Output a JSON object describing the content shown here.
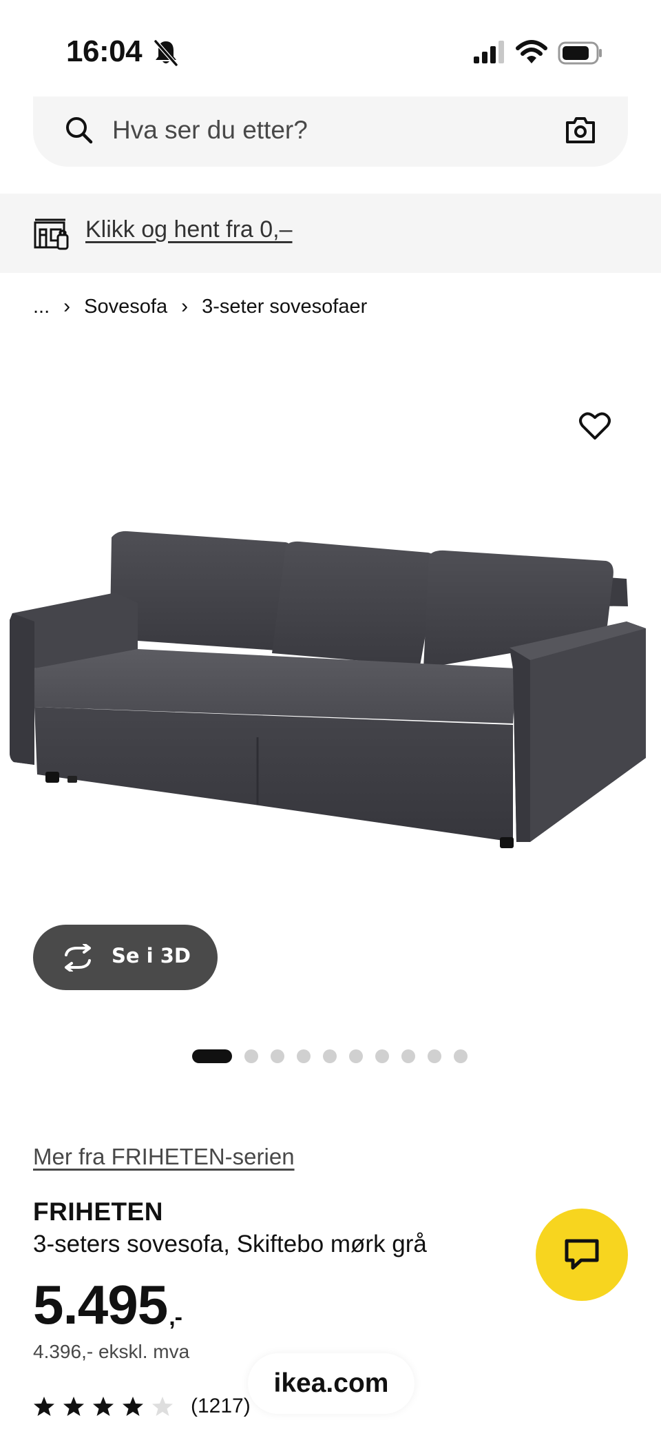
{
  "status_bar": {
    "time": "16:04"
  },
  "search": {
    "placeholder": "Hva ser du etter?"
  },
  "collect_banner": {
    "link": "Klikk og hent fra 0,–"
  },
  "breadcrumb": {
    "items": [
      "...",
      "Sovesofa",
      "3-seter sovesofaer"
    ]
  },
  "product_image": {
    "view_3d_label": "Se i 3D",
    "carousel": {
      "total": 10,
      "active": 1
    }
  },
  "product": {
    "series_link": "Mer fra FRIHETEN-serien",
    "name": "FRIHETEN",
    "description": "3-seters sovesofa, Skiftebo mørk grå",
    "price": "5.495",
    "price_suffix": ",-",
    "price_ex_vat": "4.396,- ekskl. mva",
    "rating": {
      "stars": 4,
      "max": 5,
      "count": "(1217)"
    }
  },
  "browser": {
    "url": "ikea.com"
  },
  "colors": {
    "accent_yellow": "#f7d51f",
    "button_dark": "#4a4a4a"
  }
}
